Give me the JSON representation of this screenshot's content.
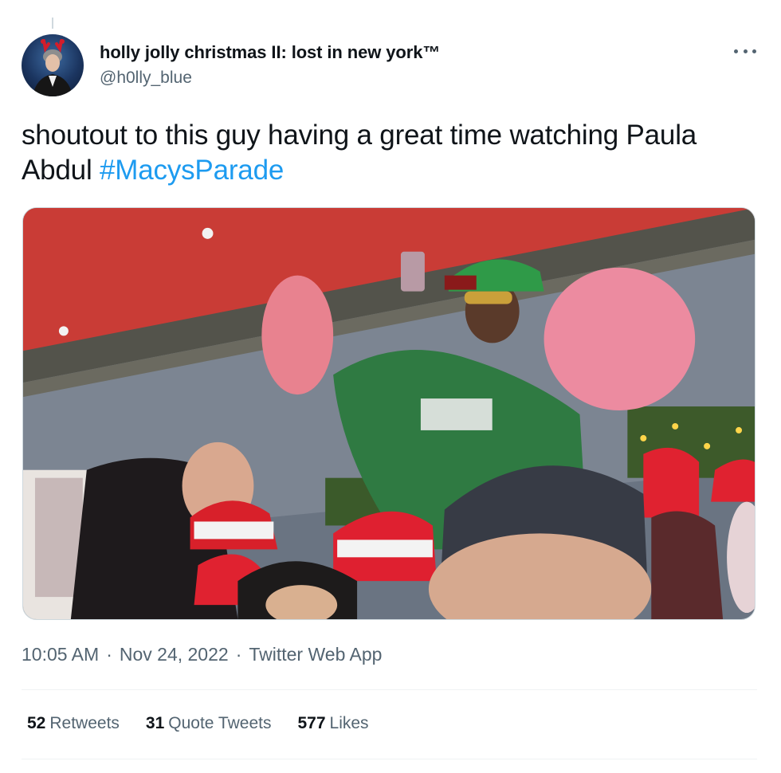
{
  "tweet": {
    "author": {
      "display_name": "holly jolly christmas II: lost in new york™",
      "handle": "@h0lly_blue"
    },
    "text": "shoutout to this guy having a great time watching Paula Abdul ",
    "hashtag": "#MacysParade",
    "media_icon": "video-still",
    "time": "10:05 AM",
    "date": "Nov 24, 2022",
    "separator": "·",
    "source": "Twitter Web App",
    "stats": {
      "retweets_count": "52",
      "retweets_label": "Retweets",
      "quotes_count": "31",
      "quotes_label": "Quote Tweets",
      "likes_count": "577",
      "likes_label": "Likes"
    }
  },
  "colors": {
    "link": "#1d9bf0",
    "secondary_text": "#536471",
    "primary_text": "#0f1419"
  }
}
